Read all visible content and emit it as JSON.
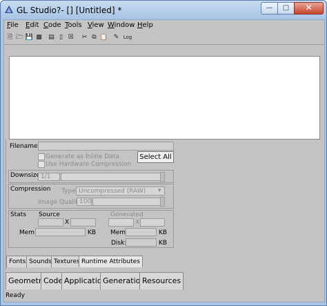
{
  "window": {
    "title": "GL Studio?-  [] [Untitled] *",
    "minimize_icon": "minimize-icon",
    "maximize_icon": "maximize-icon",
    "close_icon": "close-icon"
  },
  "menu": [
    "File",
    "Edit",
    "Code",
    "Tools",
    "View",
    "Window",
    "Help"
  ],
  "toolbar": {
    "icons": [
      "new-file-icon",
      "open-folder-icon",
      "save-icon",
      "save-all-icon",
      "properties-icon",
      "copy-page-icon",
      "delete-icon",
      "cut-icon",
      "copy-icon",
      "paste-icon",
      "edit-icon",
      "log-icon"
    ],
    "log_label": "Log"
  },
  "texture_panel": {
    "filename_label": "Filename:",
    "generate_inline": "Generate as Inline Data",
    "hardware_compression": "Use Hardware Compression",
    "select_all": "Select All",
    "downsize_label": "Downsize",
    "downsize_value": "1/1",
    "compression_label": "Compression",
    "type_label": "Type",
    "type_value": "Uncompressed (RAW)",
    "image_quality_label": "Image Quality",
    "image_quality_value": "100",
    "stats_label": "Stats",
    "source_label": "Source",
    "generated_label": "Generated",
    "x_label": "X",
    "mem_label": "Mem:",
    "disk_label": "Disk:",
    "kb": "KB"
  },
  "upper_tabs": [
    "Fonts",
    "Sounds",
    "Textures",
    "Runtime Attributes"
  ],
  "lower_tabs": [
    "Geometry",
    "Code",
    "Application",
    "Generation",
    "Resources"
  ],
  "status": "Ready"
}
